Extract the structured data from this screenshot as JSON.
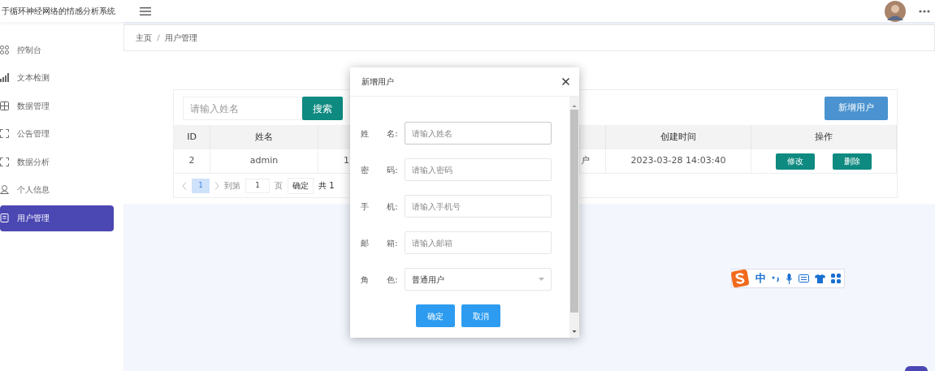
{
  "app": {
    "title": "于循环神经网络的情感分析系统"
  },
  "sidebar": {
    "items": [
      {
        "label": "控制台",
        "kind": "grid",
        "selected": false
      },
      {
        "label": "文本检测",
        "kind": "bars",
        "selected": false
      },
      {
        "label": "数据管理",
        "kind": "table",
        "selected": false
      },
      {
        "label": "公告管理",
        "kind": "expand",
        "selected": false
      },
      {
        "label": "数据分析",
        "kind": "expand",
        "selected": false
      },
      {
        "label": "个人信息",
        "kind": "person",
        "selected": false
      },
      {
        "label": "用户管理",
        "kind": "document",
        "selected": true
      }
    ]
  },
  "breadcrumb": [
    "主页",
    "用户管理"
  ],
  "search": {
    "placeholder": "请输入姓名",
    "button": "搜索"
  },
  "add_button": "新增用户",
  "table": {
    "columns": [
      "ID",
      "姓名",
      "创建时间",
      "操作"
    ],
    "rows": [
      {
        "id": "2",
        "name": "admin",
        "column_3": "1",
        "column_4": "户",
        "created": "2023-03-28 14:03:40",
        "actions": [
          "修改",
          "删除"
        ]
      }
    ]
  },
  "pagination": {
    "pages": [
      {
        "label": "1",
        "selected": true
      }
    ],
    "goto_label": "到第",
    "goto_value": "1",
    "page_unit": "页",
    "confirm": "确定",
    "total": "共 1"
  },
  "modal": {
    "title": "新增用户",
    "fields": [
      {
        "label": "姓 名:",
        "kind": "input",
        "placeholder": "请输入姓名",
        "focused": true
      },
      {
        "label": "密 码:",
        "kind": "input",
        "placeholder": "请输入密码",
        "focused": false
      },
      {
        "label": "手 机:",
        "kind": "input",
        "placeholder": "请输入手机号",
        "focused": false
      },
      {
        "label": "邮 箱:",
        "kind": "input",
        "placeholder": "请输入邮箱",
        "focused": false
      },
      {
        "label": "角 色:",
        "kind": "select",
        "value": "普通用户",
        "focused": false
      }
    ],
    "buttons": [
      "确定",
      "取消"
    ]
  },
  "ime_toolbar": {
    "mode": "中"
  }
}
